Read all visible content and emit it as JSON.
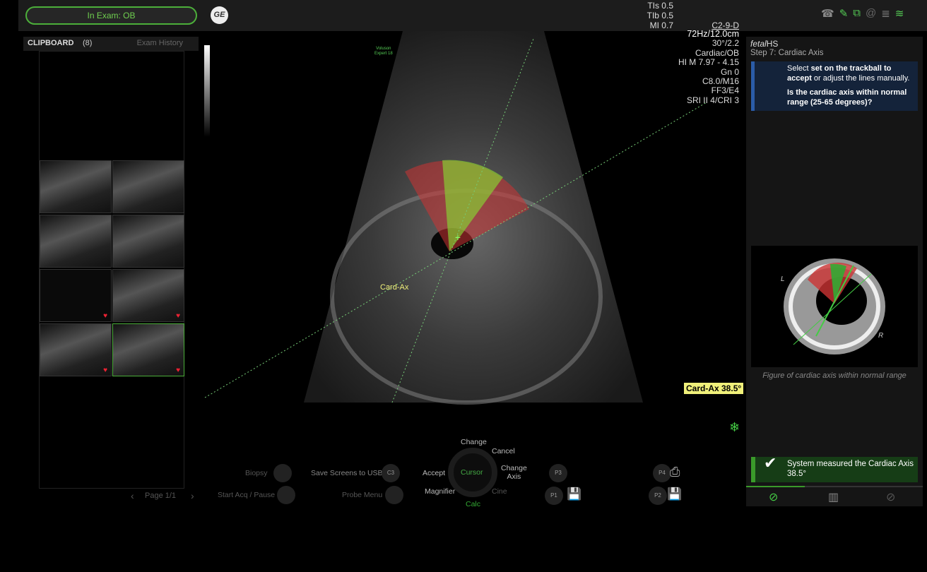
{
  "topbar": {
    "exam_label": "In Exam: OB",
    "logo": "GE",
    "tis": "TIs 0.5",
    "tib": "TIb 0.5",
    "mi": "MI 0.7",
    "probe": "C2-9-D"
  },
  "clipboard": {
    "title": "CLIPBOARD",
    "count": "(8)",
    "history_tab": "Exam History",
    "page": "Page 1/1"
  },
  "image": {
    "watermark_line1": "Voluson",
    "watermark_line2": "Expert 18",
    "label": "Card-Ax",
    "measurement": "Card-Ax 38.5°"
  },
  "params": [
    "72Hz/12.0cm",
    "30°/2.2",
    "Cardiac/OB",
    "HI M  7.97 - 4.15",
    "Gn  0",
    "C8.0/M16",
    "FF3/E4",
    "SRI II 4/CRI 3"
  ],
  "panel": {
    "app_italic": "fetal",
    "app_rest": "HS",
    "step": "Step 7: Cardiac Axis",
    "instr_pre": "Select ",
    "instr_bold1": "set on the trackball to accept",
    "instr_post": " or adjust the lines manually.",
    "question": "Is the cardiac axis within normal range (25-65 degrees)?",
    "fig_L": "L",
    "fig_R": "R",
    "caption": "Figure of cardiac axis within normal range",
    "success_line1": "System measured the Cardiac Axis",
    "success_line2": "38.5°"
  },
  "controls": {
    "biopsy": "Biopsy",
    "save_usb": "Save Screens to USB",
    "c3": "C3",
    "start_stop": "Start Acq / Pause",
    "probe_menu": "Probe Menu",
    "change": "Change",
    "cancel": "Cancel",
    "accept": "Accept",
    "cursor": "Cursor",
    "change_axis_1": "Change",
    "change_axis_2": "Axis",
    "magnifier": "Magnifier",
    "cine": "Cine",
    "calc": "Calc",
    "p1": "P1",
    "p2": "P2",
    "p3": "P3",
    "p4": "P4"
  },
  "colors": {
    "accent": "#4caf3a",
    "info": "#2b5ca8",
    "measure_bg": "#f0f07a"
  }
}
